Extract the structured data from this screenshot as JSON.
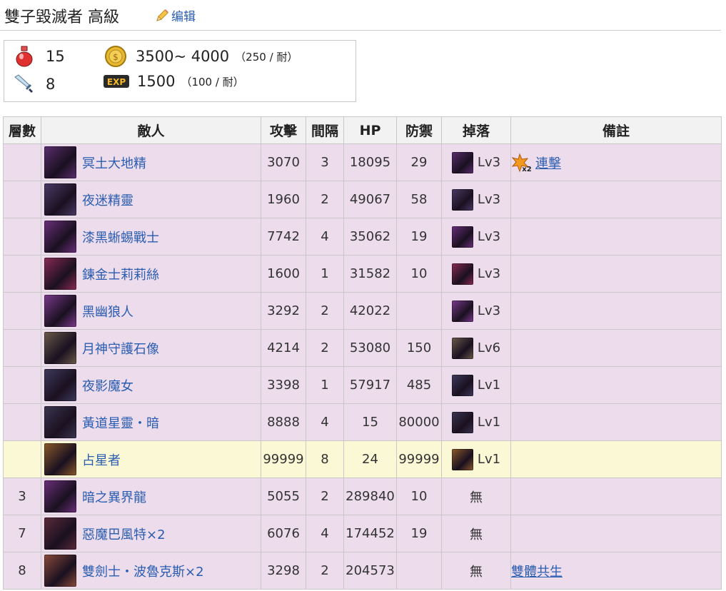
{
  "page": {
    "title": "雙子毀滅者 高級",
    "edit_label": "编辑"
  },
  "summary": {
    "stamina": "15",
    "coins": "3500~ 4000",
    "coins_note": "（250 / 耐）",
    "rounds": "8",
    "exp": "1500",
    "exp_note": "（100 / 耐）",
    "icons": [
      "potion-icon",
      "coin-icon",
      "sword-icon",
      "exp-icon"
    ]
  },
  "table": {
    "headers": [
      "層數",
      "敵人",
      "攻擊",
      "間隔",
      "HP",
      "防禦",
      "掉落",
      "備註"
    ],
    "rows": [
      {
        "floor": "",
        "name": "冥土大地精",
        "atk": "3070",
        "cd": "3",
        "hp": "18095",
        "def": "29",
        "drop": "Lv3",
        "note": "連擊",
        "color": "#5a2d6e"
      },
      {
        "floor": "",
        "name": "夜迷精靈",
        "atk": "1960",
        "cd": "2",
        "hp": "49067",
        "def": "58",
        "drop": "Lv3",
        "note": "",
        "color": "#4b3a66"
      },
      {
        "floor": "",
        "name": "漆黑蜥蜴戰士",
        "atk": "7742",
        "cd": "4",
        "hp": "35062",
        "def": "19",
        "drop": "Lv3",
        "note": "",
        "color": "#6a2f7a"
      },
      {
        "floor": "",
        "name": "鍊金士莉莉絲",
        "atk": "1600",
        "cd": "1",
        "hp": "31582",
        "def": "10",
        "drop": "Lv3",
        "note": "",
        "color": "#8a2a55"
      },
      {
        "floor": "",
        "name": "黑幽狼人",
        "atk": "3292",
        "cd": "2",
        "hp": "42022",
        "def": "",
        "drop": "Lv3",
        "note": "",
        "color": "#7a3a8c"
      },
      {
        "floor": "",
        "name": "月神守護石像",
        "atk": "4214",
        "cd": "2",
        "hp": "53080",
        "def": "150",
        "drop": "Lv6",
        "note": "",
        "color": "#6b5a4a"
      },
      {
        "floor": "",
        "name": "夜影魔女",
        "atk": "3398",
        "cd": "1",
        "hp": "57917",
        "def": "485",
        "drop": "Lv1",
        "note": "",
        "color": "#3e3a5c"
      },
      {
        "floor": "",
        "name": "黃道星靈・暗",
        "atk": "8888",
        "cd": "4",
        "hp": "15",
        "def": "80000",
        "drop": "Lv1",
        "note": "",
        "color": "#3a3550"
      },
      {
        "floor": "",
        "name": "占星者",
        "atk": "99999",
        "cd": "8",
        "hp": "24",
        "def": "99999",
        "drop": "Lv1",
        "note": "",
        "color": "#8a5a2a",
        "boss": true
      },
      {
        "floor": "3",
        "name": "暗之異界龍",
        "atk": "5055",
        "cd": "2",
        "hp": "289840",
        "def": "10",
        "drop": "無",
        "note": "",
        "color": "#6a2f7a"
      },
      {
        "floor": "7",
        "name": "惡魔巴風特×2",
        "atk": "6076",
        "cd": "4",
        "hp": "174452",
        "def": "19",
        "drop": "無",
        "note": "",
        "color": "#5a2a3a"
      },
      {
        "floor": "8",
        "name": "雙劍士・波魯克斯×2",
        "atk": "3298",
        "cd": "2",
        "hp": "204573",
        "def": "",
        "drop": "無",
        "note": "雙體共生",
        "color": "#8a4a3a"
      }
    ]
  }
}
